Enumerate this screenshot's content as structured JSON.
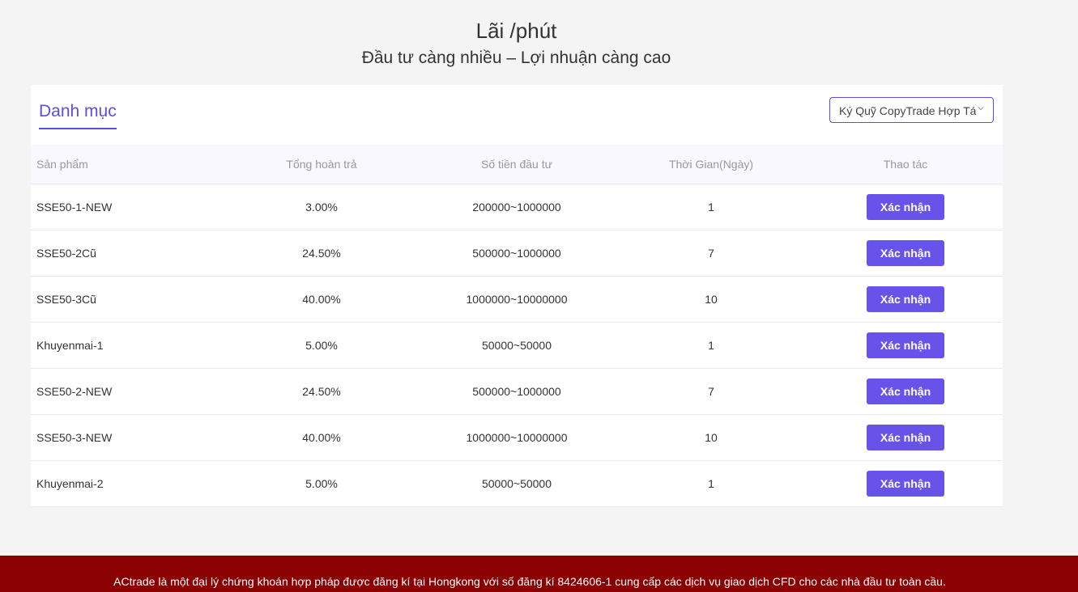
{
  "header": {
    "title": "Lãi /phút",
    "subtitle": "Đầu tư càng nhiều – Lợi nhuận càng cao"
  },
  "tabs": {
    "active_label": "Danh mục"
  },
  "filter": {
    "selected": "Ký Quỹ CopyTrade Hợp Tá"
  },
  "table": {
    "columns": [
      "Sản phẩm",
      "Tổng hoàn trả",
      "Số tiền đầu tư",
      "Thời Gian(Ngày)",
      "Thao tác"
    ],
    "rows": [
      {
        "product": "SSE50-1-NEW",
        "return": "3.00%",
        "amount": "200000~1000000",
        "days": "1",
        "action": "Xác nhận"
      },
      {
        "product": "SSE50-2Cũ",
        "return": "24.50%",
        "amount": "500000~1000000",
        "days": "7",
        "action": "Xác nhận"
      },
      {
        "product": "SSE50-3Cũ",
        "return": "40.00%",
        "amount": "1000000~10000000",
        "days": "10",
        "action": "Xác nhận"
      },
      {
        "product": "Khuyenmai-1",
        "return": "5.00%",
        "amount": "50000~50000",
        "days": "1",
        "action": "Xác nhận"
      },
      {
        "product": "SSE50-2-NEW",
        "return": "24.50%",
        "amount": "500000~1000000",
        "days": "7",
        "action": "Xác nhận"
      },
      {
        "product": "SSE50-3-NEW",
        "return": "40.00%",
        "amount": "1000000~10000000",
        "days": "10",
        "action": "Xác nhận"
      },
      {
        "product": "Khuyenmai-2",
        "return": "5.00%",
        "amount": "50000~50000",
        "days": "1",
        "action": "Xác nhận"
      }
    ]
  },
  "footer": {
    "text": "ACtrade là một đại lý chứng khoán hợp pháp được đăng kí tại Hongkong với số đăng kí 8424606-1 cung cấp các dịch vụ giao dịch CFD cho các nhà đầu tư toàn cầu."
  },
  "colors": {
    "accent": "#6753ea",
    "footer_bg": "#8b0000",
    "page_bg": "#f4f4f4"
  },
  "icons": {
    "select_arrow": "chevron-down-icon"
  }
}
